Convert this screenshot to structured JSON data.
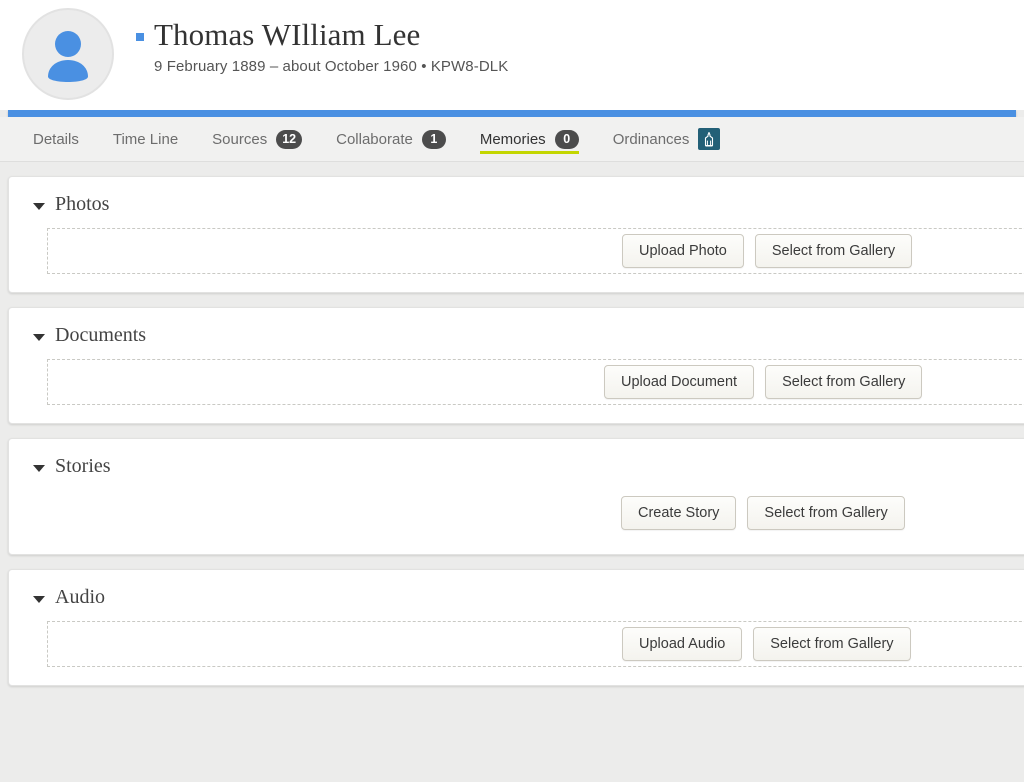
{
  "header": {
    "avatar_icon": "person-silhouette-icon",
    "gender_marker_color": "#4a90e2",
    "name": "Thomas WIlliam Lee",
    "lifespan_and_id": "9 February 1889 – about October 1960 • KPW8-DLK",
    "accent_bar_color": "#4a90e2"
  },
  "tabs": {
    "active_underline_color": "#c3d600",
    "items": [
      {
        "label": "Details",
        "badge": null,
        "active": false,
        "icon": null
      },
      {
        "label": "Time Line",
        "badge": null,
        "active": false,
        "icon": null
      },
      {
        "label": "Sources",
        "badge": "12",
        "active": false,
        "icon": null
      },
      {
        "label": "Collaborate",
        "badge": "1",
        "active": false,
        "icon": null
      },
      {
        "label": "Memories",
        "badge": "0",
        "active": true,
        "icon": null
      },
      {
        "label": "Ordinances",
        "badge": null,
        "active": false,
        "icon": "temple-icon"
      }
    ]
  },
  "sections": [
    {
      "title": "Photos",
      "expanded": true,
      "has_dropzone": true,
      "primary_button": "Upload Photo",
      "secondary_button": "Select from Gallery"
    },
    {
      "title": "Documents",
      "expanded": true,
      "has_dropzone": true,
      "primary_button": "Upload Document",
      "secondary_button": "Select from Gallery"
    },
    {
      "title": "Stories",
      "expanded": true,
      "has_dropzone": false,
      "primary_button": "Create Story",
      "secondary_button": "Select from Gallery"
    },
    {
      "title": "Audio",
      "expanded": true,
      "has_dropzone": true,
      "primary_button": "Upload Audio",
      "secondary_button": "Select from Gallery"
    }
  ]
}
